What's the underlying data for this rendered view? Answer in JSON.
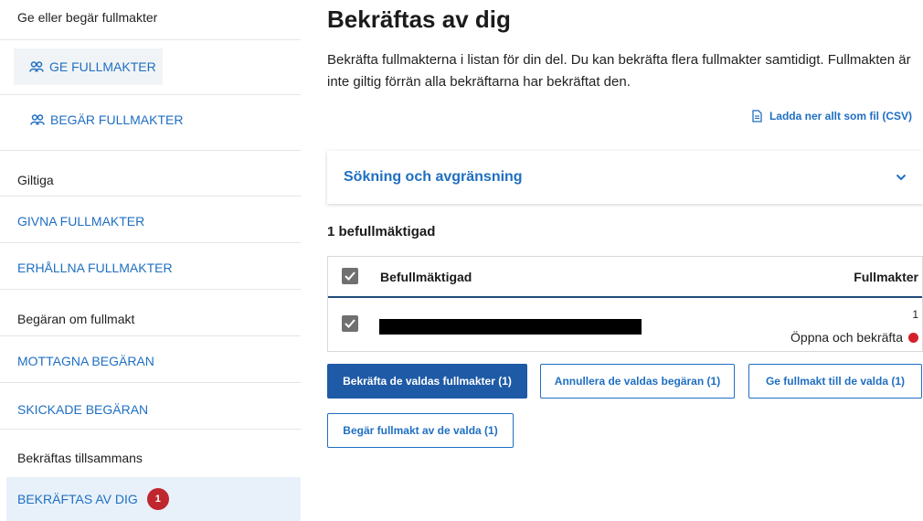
{
  "sidebar": {
    "section_ge": "Ge eller begär fullmakter",
    "ge_fullmakter": "GE FULLMAKTER",
    "begar_fullmakter": "BEGÄR FULLMAKTER",
    "section_giltiga": "Giltiga",
    "givna": "GIVNA FULLMAKTER",
    "erhallna": "ERHÅLLNA FULLMAKTER",
    "section_begaran": "Begäran om fullmakt",
    "mottagna": "MOTTAGNA BEGÄRAN",
    "skickade": "SKICKADE BEGÄRAN",
    "section_bekraftas": "Bekräftas tillsammans",
    "bekraftas_av_dig": "BEKRÄFTAS AV DIG",
    "bekraftas_badge": "1"
  },
  "main": {
    "title": "Bekräftas av dig",
    "intro": "Bekräfta fullmakterna i listan för din del. Du kan bekräfta flera fullmakter samtidigt. Fullmakten är inte giltig förrän alla bekräftarna har bekräftat den.",
    "csv_link": "Ladda ner allt som fil (CSV)",
    "accordion_label": "Sökning och avgränsning",
    "count_label": "1 befullmäktigad"
  },
  "table": {
    "col_name": "Befullmäktigad",
    "col_fullmakter": "Fullmakter",
    "rows": [
      {
        "fullmakter_count": "1",
        "action": "Öppna och bekräfta"
      }
    ]
  },
  "buttons": {
    "confirm": "Bekräfta de valdas fullmakter (1)",
    "cancel": "Annullera de valdas begäran (1)",
    "give": "Ge fullmakt till de valda (1)",
    "request": "Begär fullmakt av de valda (1)"
  },
  "colors": {
    "link": "#1f6fc2",
    "primary": "#1e5aa6",
    "badge": "#c0262d",
    "status_dot": "#d4202a"
  }
}
